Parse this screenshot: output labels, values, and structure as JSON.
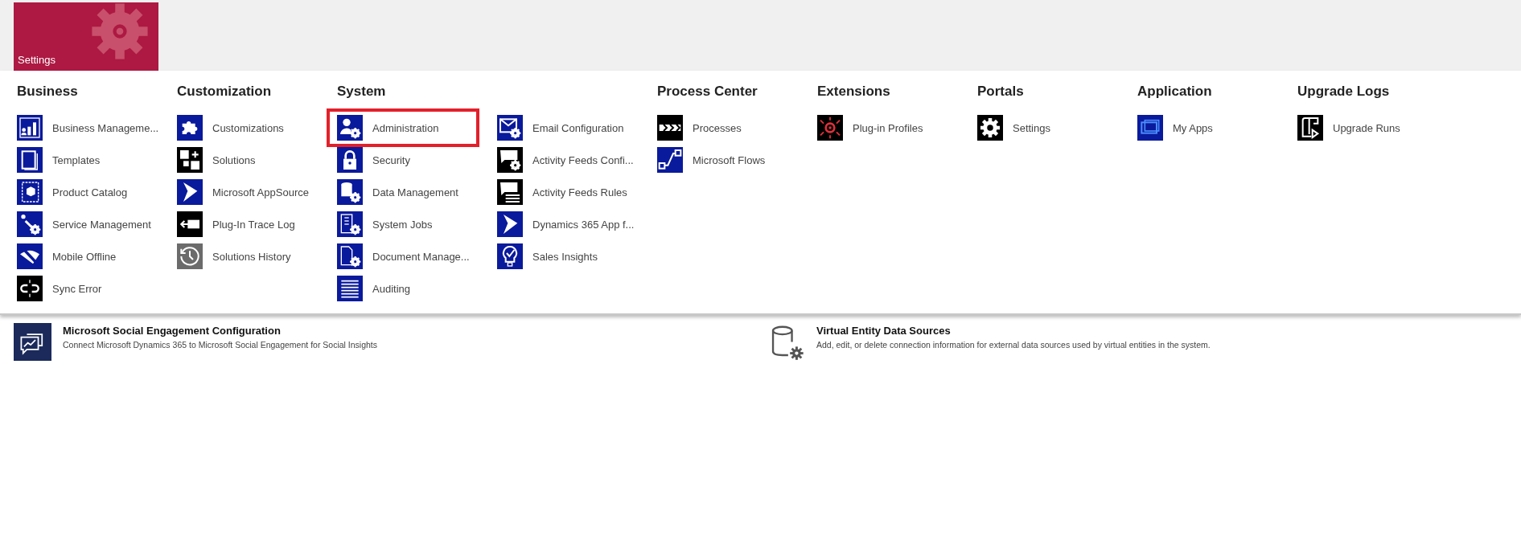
{
  "tile": {
    "label": "Settings"
  },
  "groups": [
    {
      "title": "Business",
      "items": [
        {
          "label": "Business Manageme...",
          "kind": "chart",
          "color": "#0a1a9c",
          "highlighted": false
        },
        {
          "label": "Templates",
          "kind": "pages",
          "color": "#0a1a9c",
          "highlighted": false
        },
        {
          "label": "Product Catalog",
          "kind": "box",
          "color": "#0a1a9c",
          "highlighted": false
        },
        {
          "label": "Service Management",
          "kind": "wrench",
          "color": "#0a1a9c",
          "highlighted": false
        },
        {
          "label": "Mobile Offline",
          "kind": "offline",
          "color": "#0a1a9c",
          "highlighted": false
        },
        {
          "label": "Sync Error",
          "kind": "unlink",
          "color": "#000000",
          "highlighted": false
        }
      ]
    },
    {
      "title": "Customization",
      "items": [
        {
          "label": "Customizations",
          "kind": "puzzle",
          "color": "#0a1a9c",
          "highlighted": false
        },
        {
          "label": "Solutions",
          "kind": "squares",
          "color": "#000000",
          "highlighted": false
        },
        {
          "label": "Microsoft AppSource",
          "kind": "play",
          "color": "#0a1a9c",
          "highlighted": false
        },
        {
          "label": "Plug-In Trace Log",
          "kind": "plug",
          "color": "#000000",
          "highlighted": false
        },
        {
          "label": "Solutions History",
          "kind": "history",
          "color": "#6b6b6b",
          "highlighted": false
        }
      ]
    },
    {
      "title": "System",
      "items": [
        {
          "label": "Administration",
          "kind": "usergear",
          "color": "#0a1a9c",
          "highlighted": true
        },
        {
          "label": "Security",
          "kind": "lock",
          "color": "#0a1a9c",
          "highlighted": false
        },
        {
          "label": "Data Management",
          "kind": "dbgear",
          "color": "#0a1a9c",
          "highlighted": false
        },
        {
          "label": "System Jobs",
          "kind": "listgear",
          "color": "#0a1a9c",
          "highlighted": false
        },
        {
          "label": "Document Manage...",
          "kind": "docgear",
          "color": "#0a1a9c",
          "highlighted": false
        },
        {
          "label": "Auditing",
          "kind": "list",
          "color": "#0a1a9c",
          "highlighted": false
        },
        {
          "label": "Email Configuration",
          "kind": "mailgear",
          "color": "#0a1a9c",
          "highlighted": false
        },
        {
          "label": "Activity Feeds Confi...",
          "kind": "chatgear",
          "color": "#000000",
          "highlighted": false
        },
        {
          "label": "Activity Feeds Rules",
          "kind": "chatlist",
          "color": "#000000",
          "highlighted": false
        },
        {
          "label": "Dynamics 365 App f...",
          "kind": "play",
          "color": "#0a1a9c",
          "highlighted": false
        },
        {
          "label": "Sales Insights",
          "kind": "bulb",
          "color": "#0a1a9c",
          "highlighted": false
        }
      ]
    },
    {
      "title": "Process Center",
      "items": [
        {
          "label": "Processes",
          "kind": "chevrons",
          "color": "#000000",
          "highlighted": false
        },
        {
          "label": "Microsoft Flows",
          "kind": "flow",
          "color": "#0a1a9c",
          "highlighted": false
        }
      ]
    },
    {
      "title": "Extensions",
      "items": [
        {
          "label": "Plug-in Profiles",
          "kind": "target",
          "color": "#000000",
          "highlighted": false
        }
      ]
    },
    {
      "title": "Portals",
      "items": [
        {
          "label": "Settings",
          "kind": "gear",
          "color": "#000000",
          "highlighted": false
        }
      ]
    },
    {
      "title": "Application",
      "items": [
        {
          "label": "My Apps",
          "kind": "windows",
          "color": "#0a1a9c",
          "highlighted": false
        }
      ]
    },
    {
      "title": "Upgrade Logs",
      "items": [
        {
          "label": "Upgrade Runs",
          "kind": "scroll",
          "color": "#000000",
          "highlighted": false
        }
      ]
    }
  ],
  "cards": [
    {
      "title": "Microsoft Social Engagement Configuration",
      "description": "Connect Microsoft Dynamics 365 to Microsoft Social Engagement for Social Insights",
      "kind": "chatchart"
    },
    {
      "title": "Virtual Entity Data Sources",
      "description": "Add, edit, or delete connection information for external data sources used by virtual entities in the system.",
      "kind": "dbgear"
    }
  ]
}
